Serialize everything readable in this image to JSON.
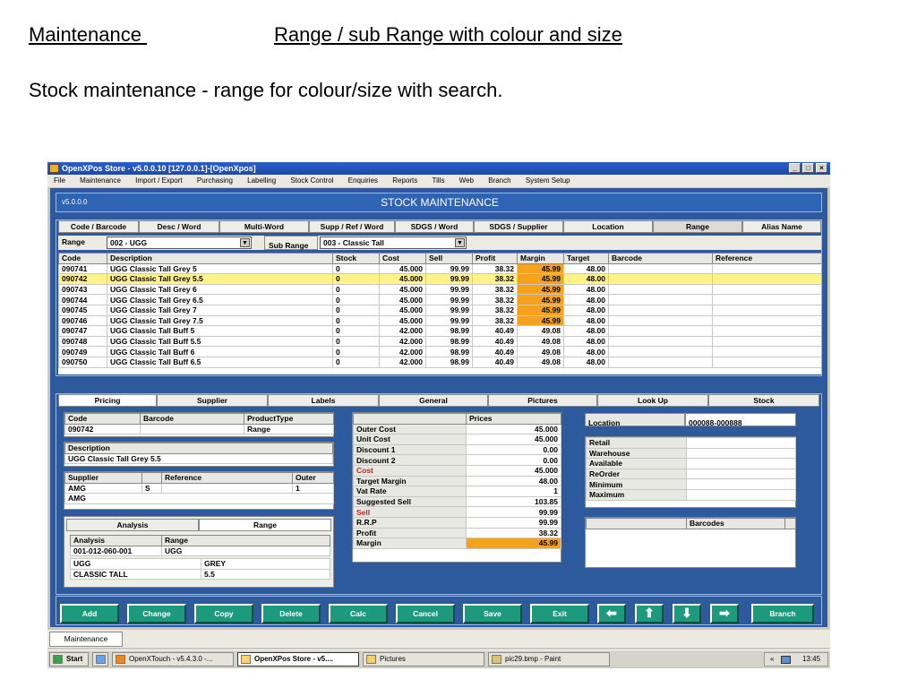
{
  "slide": {
    "heading_left": "Maintenance ",
    "heading_right": "Range / sub Range with colour and size",
    "subtitle": "Stock maintenance - range for colour/size with search."
  },
  "window": {
    "title": "OpenXPos Store - v5.0.0.10 [127.0.0.1]-[OpenXpos]",
    "controls": [
      "_",
      "□",
      "×"
    ],
    "menu": [
      "File",
      "Maintenance",
      "Import / Export",
      "Purchasing",
      "Labelling",
      "Stock Control",
      "Enquiries",
      "Reports",
      "Tills",
      "Web",
      "Branch",
      "System Setup"
    ]
  },
  "header": {
    "version": "v5.0.0.0",
    "title": "STOCK MAINTENANCE"
  },
  "search_tabs": [
    "Code / Barcode",
    "Desc / Word",
    "Multi-Word",
    "Supp / Ref / Word",
    "SDGS / Word",
    "SDGS / Supplier",
    "Location",
    "Range",
    "Alias Name"
  ],
  "search_tab_selected": "Range",
  "filters": {
    "range_label": "Range",
    "range_value": "002 - UGG",
    "subrange_label": "Sub Range",
    "subrange_value": "003 - Classic Tall"
  },
  "grid": {
    "columns": [
      "Code",
      "Description",
      "Stock",
      "Cost",
      "Sell",
      "Profit",
      "Margin",
      "Target",
      "Barcode",
      "Reference"
    ],
    "rows": [
      [
        "090741",
        "UGG Classic Tall Grey 5",
        "0",
        "45.000",
        "99.99",
        "38.32",
        "45.99",
        "48.00",
        "",
        ""
      ],
      [
        "090742",
        "UGG Classic Tall Grey 5.5",
        "0",
        "45.000",
        "99.99",
        "38.32",
        "45.99",
        "48.00",
        "",
        ""
      ],
      [
        "090743",
        "UGG Classic Tall Grey 6",
        "0",
        "45.000",
        "99.99",
        "38.32",
        "45.99",
        "48.00",
        "",
        ""
      ],
      [
        "090744",
        "UGG Classic Tall Grey 6.5",
        "0",
        "45.000",
        "99.99",
        "38.32",
        "45.99",
        "48.00",
        "",
        ""
      ],
      [
        "090745",
        "UGG Classic Tall Grey 7",
        "0",
        "45.000",
        "99.99",
        "38.32",
        "45.99",
        "48.00",
        "",
        ""
      ],
      [
        "090746",
        "UGG Classic Tall Grey 7.5",
        "0",
        "45.000",
        "99.99",
        "38.32",
        "45.99",
        "48.00",
        "",
        ""
      ],
      [
        "090747",
        "UGG Classic Tall Buff 5",
        "0",
        "42.000",
        "98.99",
        "40.49",
        "49.08",
        "48.00",
        "",
        ""
      ],
      [
        "090748",
        "UGG Classic Tall Buff 5.5",
        "0",
        "42.000",
        "98.99",
        "40.49",
        "49.08",
        "48.00",
        "",
        ""
      ],
      [
        "090749",
        "UGG Classic Tall Buff 6",
        "0",
        "42.000",
        "98.99",
        "40.49",
        "49.08",
        "48.00",
        "",
        ""
      ],
      [
        "090750",
        "UGG Classic Tall Buff 6.5",
        "0",
        "42.000",
        "98.99",
        "40.49",
        "49.08",
        "48.00",
        "",
        ""
      ]
    ],
    "selected_row": 1,
    "highlight_margin_rows": 6
  },
  "detail_tabs": [
    "Pricing",
    "Supplier",
    "Labels",
    "General",
    "Pictures",
    "Look Up",
    "Stock"
  ],
  "detail_tab_selected": "Pricing",
  "product": {
    "code_label": "Code",
    "barcode_label": "Barcode",
    "type_label": "ProductType",
    "code": "090742",
    "barcode": "",
    "type": "Range",
    "description_label": "Description",
    "description": "UGG Classic Tall Grey 5.5",
    "supplier_label": "Supplier",
    "reference_label": "Reference",
    "outer_label": "Outer",
    "supplier_code": "AMG",
    "supplier_flag": "S",
    "reference": "",
    "outer": "1",
    "supplier_name": "AMG"
  },
  "analysis": {
    "tabs": [
      "Analysis",
      "Range"
    ],
    "col_analysis": "Analysis",
    "col_range": "Range",
    "analysis_code": "001-012-060-001",
    "range_code": "UGG",
    "rows": [
      [
        "UGG",
        "GREY"
      ],
      [
        "CLASSIC TALL",
        "5.5"
      ]
    ]
  },
  "prices": {
    "header": "Prices",
    "rows": [
      [
        "Outer Cost",
        "45.000"
      ],
      [
        "Unit Cost",
        "45.000"
      ],
      [
        "Discount 1",
        "0.00"
      ],
      [
        "Discount 2",
        "0.00"
      ],
      [
        "Cost",
        "45.000"
      ],
      [
        "Target Margin",
        "48.00"
      ],
      [
        "Vat Rate",
        "1"
      ],
      [
        "Suggested Sell",
        "103.85"
      ],
      [
        "Sell",
        "99.99"
      ],
      [
        "R.R.P",
        "99.99"
      ],
      [
        "Profit",
        "38.32"
      ],
      [
        "Margin",
        "45.99"
      ]
    ]
  },
  "location": {
    "label": "Location",
    "value": "000088-000888",
    "stock_rows": [
      "Retail",
      "Warehouse",
      "Available",
      "ReOrder",
      "Minimum",
      "Maximum"
    ],
    "barcodes_label": "Barcodes"
  },
  "actions": {
    "add": "Add",
    "change": "Change",
    "copy": "Copy",
    "delete": "Delete",
    "calc": "Calc",
    "cancel": "Cancel",
    "save": "Save",
    "exit": "Exit",
    "branch": "Branch",
    "arrows": [
      "⬅",
      "⬆",
      "⬇",
      "➡"
    ]
  },
  "app_tab": "Maintenance",
  "taskbar": {
    "start": "Start",
    "items": [
      "OpenXTouch - v5.4.3.0 -...",
      "OpenXPos Store - v5....",
      "Pictures",
      "pic29.bmp - Paint"
    ],
    "active": 1,
    "tray_arrows": "«",
    "clock": "13:45"
  },
  "colors": {
    "accent": "#2c5a9c",
    "button": "#1d9a7e",
    "highlight": "#fff38a",
    "margin": "#f7a21b"
  }
}
